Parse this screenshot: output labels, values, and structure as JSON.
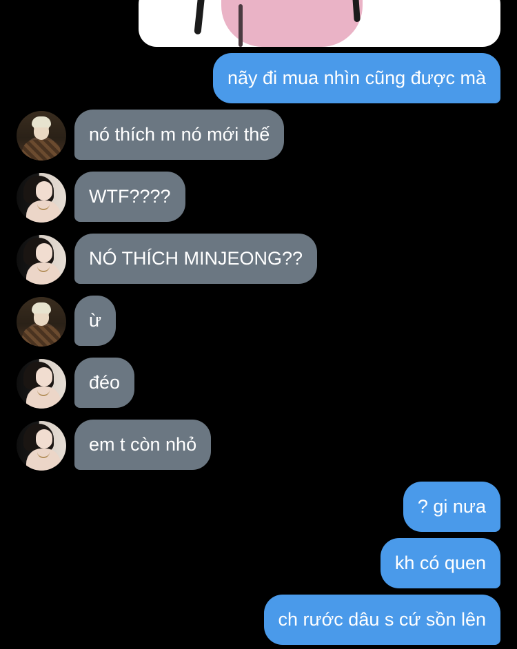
{
  "colors": {
    "background": "#000000",
    "sent_bubble": "#4a9aea",
    "received_bubble": "#6b7782",
    "text": "#ffffff"
  },
  "shared_image": {
    "icon": "cartoon-image-thumbnail"
  },
  "messages": [
    {
      "direction": "sent",
      "text": "nãy đi mua nhìn cũng được mà"
    },
    {
      "direction": "received",
      "avatar": "male-avatar",
      "text": "nó thích m nó mới thế"
    },
    {
      "direction": "received",
      "avatar": "female-avatar",
      "text": "WTF????"
    },
    {
      "direction": "received",
      "avatar": "female-avatar",
      "text": "NÓ THÍCH MINJEONG??"
    },
    {
      "direction": "received",
      "avatar": "male-avatar",
      "text": "ừ"
    },
    {
      "direction": "received",
      "avatar": "female-avatar",
      "text": "đéo"
    },
    {
      "direction": "received",
      "avatar": "female-avatar",
      "text": "em t còn nhỏ"
    },
    {
      "direction": "sent",
      "text": "? gi nưa"
    },
    {
      "direction": "sent",
      "text": "kh có quen"
    },
    {
      "direction": "sent",
      "text": "ch rước dâu s cứ sồn lên"
    }
  ]
}
